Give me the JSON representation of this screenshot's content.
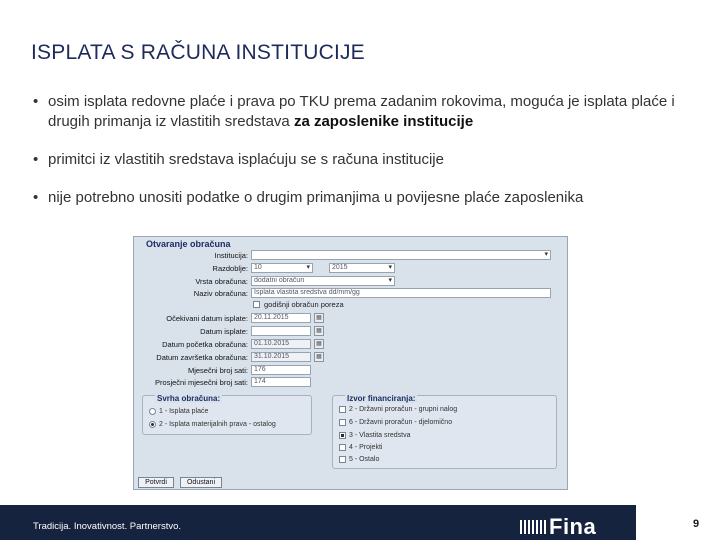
{
  "slide": {
    "title": "ISPLATA S RAČUNA INSTITUCIJE",
    "bullets": [
      {
        "marker": "•",
        "text": "osim isplata redovne plaće i prava po TKU prema zadanim rokovima, moguća je isplata plaće i drugih primanja iz vlastitih sredstava ",
        "bold": "za zaposlenike institucije"
      },
      {
        "marker": "•",
        "text": "primitci iz vlastitih sredstava isplaćuju se s računa institucije"
      },
      {
        "marker": "•",
        "text": "nije potrebno unositi podatke o drugim primanjima u povijesne plaće zaposlenika"
      }
    ]
  },
  "app": {
    "group_title": "Otvaranje obračuna",
    "fields": {
      "institucija": {
        "label": "Institucija:",
        "value": ""
      },
      "razdoblje": {
        "label": "Razdoblje:",
        "month": "10",
        "year": "2015"
      },
      "vrsta": {
        "label": "Vrsta obračuna:",
        "value": "dodatni obračun"
      },
      "naziv": {
        "label": "Naziv obračuna:",
        "value": "Isplata vlastita sredstva dd/mm/gg"
      },
      "godisnji": {
        "label": "godišnji obračun poreza"
      },
      "ocekivani": {
        "label": "Očekivani datum isplate:",
        "value": "20.11.2015"
      },
      "datum_isplate": {
        "label": "Datum isplate:",
        "value": ""
      },
      "pocetak": {
        "label": "Datum početka obračuna:",
        "value": "01.10.2015"
      },
      "zavrsetak": {
        "label": "Datum završetka obračuna:",
        "value": "31.10.2015"
      },
      "mjesecni": {
        "label": "Mjesečni broj sati:",
        "value": "176"
      },
      "prosjecni": {
        "label": "Prosječni mjesečni broj sati:",
        "value": "174"
      }
    },
    "svrha": {
      "title": "Svrha obračuna:",
      "options": [
        "1 - Isplata plaće",
        "2 - Isplata materijalnih prava - ostalog"
      ],
      "selected": 1
    },
    "izvor": {
      "title": "Izvor financiranja:",
      "options": [
        "2 - Državni proračun - grupni nalog",
        "6 - Državni proračun - djelomično",
        "3 - Vlastita sredstva",
        "4 - Projekti",
        "5 - Ostalo"
      ],
      "checked": [
        2
      ]
    },
    "buttons": {
      "ok": "Potvrdi",
      "cancel": "Odustani"
    }
  },
  "footer": {
    "tagline": "Tradicija. Inovativnost. Partnerstvo.",
    "logo_text": "Fina",
    "page_number": "9"
  },
  "colors": {
    "title": "#1f2a5c",
    "footer_bg": "#15233f",
    "app_bg": "#d9e1ea"
  }
}
